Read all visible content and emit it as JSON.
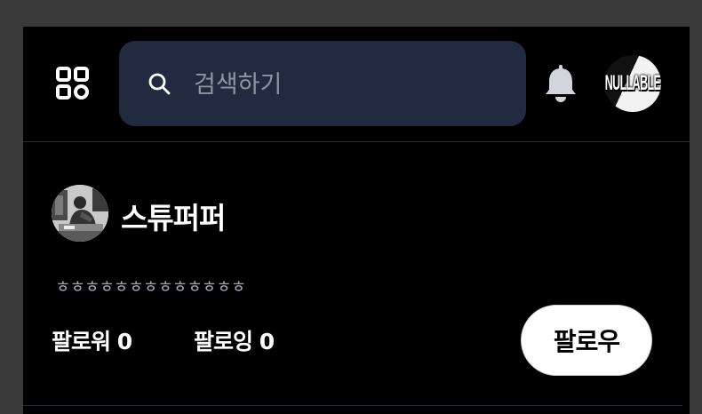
{
  "header": {
    "menu_icon": "grid-menu-icon",
    "search": {
      "placeholder": "검색하기",
      "icon": "search-icon"
    },
    "notification_icon": "bell-icon",
    "brand_avatar_text": "NULLABLE"
  },
  "profile": {
    "name": "스튜퍼퍼",
    "bio": "ㅎㅎㅎㅎㅎㅎㅎㅎㅎㅎㅎㅎㅎ",
    "followers_label": "팔로워",
    "followers_count": "0",
    "following_label": "팔로잉",
    "following_count": "0",
    "follow_button_label": "팔로우"
  },
  "colors": {
    "background": "#000000",
    "search_bg": "#212a3e",
    "divider": "#2a3240",
    "muted_text": "#9ca3af"
  }
}
